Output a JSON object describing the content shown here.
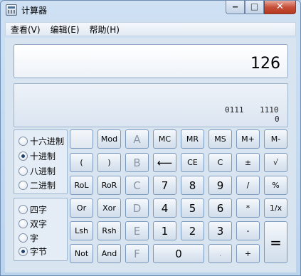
{
  "window": {
    "title": "计算器"
  },
  "caption": {
    "minimize": "‒",
    "maximize": "□",
    "close": "✕"
  },
  "menu": [
    "查看(V)",
    "编辑(E)",
    "帮助(H)"
  ],
  "display": {
    "value": "126",
    "bits_left": "0111",
    "bits_right": "1110",
    "bits_right_index": "0"
  },
  "base_group": [
    {
      "label": "十六进制",
      "checked": false
    },
    {
      "label": "十进制",
      "checked": true
    },
    {
      "label": "八进制",
      "checked": false
    },
    {
      "label": "二进制",
      "checked": false
    }
  ],
  "word_group": [
    {
      "label": "四字",
      "checked": false
    },
    {
      "label": "双字",
      "checked": false
    },
    {
      "label": "字",
      "checked": false
    },
    {
      "label": "字节",
      "checked": true
    }
  ],
  "keys": {
    "blank": "",
    "mod": "Mod",
    "A": "A",
    "MC": "MC",
    "MR": "MR",
    "MS": "MS",
    "Mplus": "M+",
    "Mminus": "M-",
    "lparen": "(",
    "rparen": ")",
    "B": "B",
    "backspace": "⟵",
    "CE": "CE",
    "C": "C",
    "plusminus": "±",
    "sqrt": "√",
    "RoL": "RoL",
    "RoR": "RoR",
    "Chex": "C",
    "seven": "7",
    "eight": "8",
    "nine": "9",
    "divide": "/",
    "percent": "%",
    "Or": "Or",
    "Xor": "Xor",
    "D": "D",
    "four": "4",
    "five": "5",
    "six": "6",
    "multiply": "*",
    "reciprocal": "1/x",
    "Lsh": "Lsh",
    "Rsh": "Rsh",
    "E": "E",
    "one": "1",
    "two": "2",
    "three": "3",
    "minus": "-",
    "equals": "=",
    "Not": "Not",
    "And": "And",
    "F": "F",
    "zero": "0",
    "dot": ".",
    "plus": "+"
  }
}
